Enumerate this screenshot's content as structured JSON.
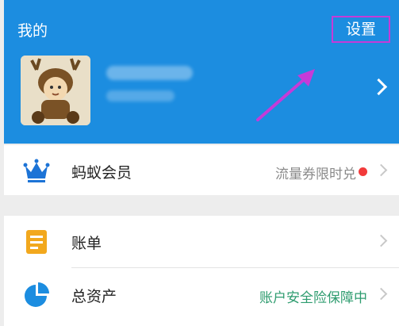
{
  "header": {
    "title": "我的",
    "settings_label": "设置"
  },
  "colors": {
    "header_bg": "#1c8de0",
    "accent_highlight": "#c53bd8",
    "status_green": "#2e9c6f",
    "notification_red": "#f23a3a"
  },
  "menu": [
    {
      "label": "蚂蚁会员",
      "right_text": "流量券限时兑",
      "icon": "crown-icon",
      "has_dot": true
    },
    {
      "label": "账单",
      "right_text": "",
      "icon": "bill-icon",
      "has_dot": false
    },
    {
      "label": "总资产",
      "right_text": "账户安全险保障中",
      "icon": "pie-chart-icon",
      "has_dot": false
    }
  ]
}
